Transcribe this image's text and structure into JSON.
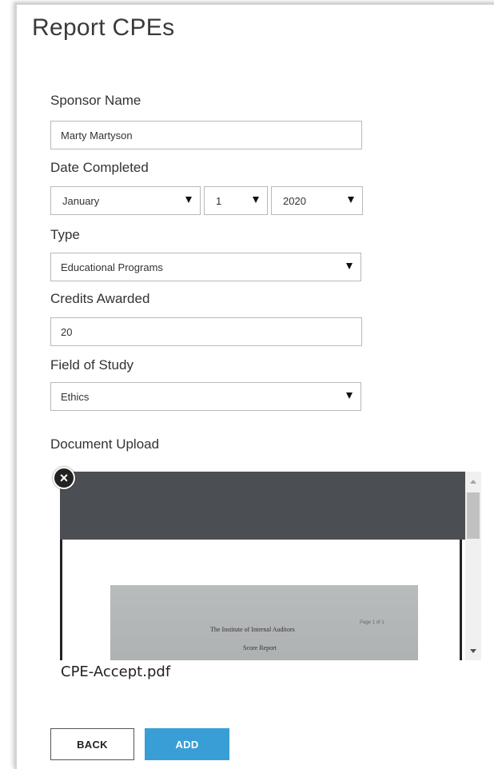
{
  "page": {
    "title": "Report CPEs"
  },
  "form": {
    "sponsor_label": "Sponsor Name",
    "sponsor_value": "Marty Martyson",
    "date_label": "Date Completed",
    "date_month": "January",
    "date_day": "1",
    "date_year": "2020",
    "type_label": "Type",
    "type_value": "Educational Programs",
    "credits_label": "Credits Awarded",
    "credits_value": "20",
    "field_label": "Field of Study",
    "field_value": "Ethics",
    "upload_label": "Document Upload"
  },
  "upload": {
    "filename": "CPE-Accept.pdf",
    "preview_line1": "The Institute of Internal Auditors",
    "preview_line2": "Score Report",
    "preview_page": "Page 1 of 1",
    "close_glyph": "×"
  },
  "actions": {
    "back_label": "BACK",
    "add_label": "ADD"
  },
  "colors": {
    "primary": "#3a9ed6",
    "toolbar": "#4b4f54"
  },
  "icons": [
    "close-icon",
    "chevron-down-icon",
    "scroll-up-icon",
    "scroll-down-icon"
  ]
}
